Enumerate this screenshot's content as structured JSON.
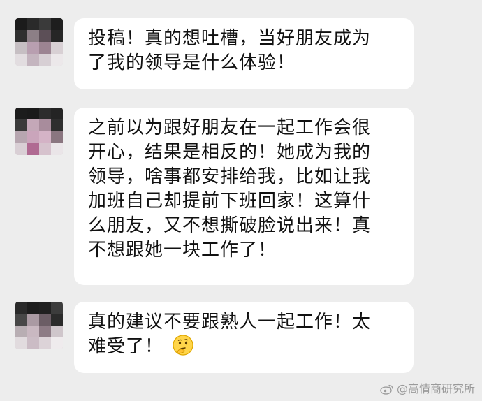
{
  "messages": [
    {
      "lines": [
        "投稿！真的想吐槽，当好朋友成为",
        "了我的领导是什么体验！"
      ]
    },
    {
      "lines": [
        "之前以为跟好朋友在一起工作会很",
        "开心，结果是相反的！她成为我的",
        "领导，啥事都安排给我，比如让我",
        "加班自己却提前下班回家！这算什",
        "么朋友，又不想撕破脸说出来！真",
        "不想跟她一块工作了！"
      ]
    },
    {
      "lines": [
        "真的建议不要跟熟人一起工作！太",
        "难受了！"
      ],
      "emoji": "thinking-face-icon"
    }
  ],
  "watermark": {
    "icon": "weibo-icon",
    "text": "@高情商研究所"
  },
  "colors": {
    "background": "#ededed",
    "bubble": "#ffffff",
    "text": "#111111",
    "watermark": "#9a9a9a"
  }
}
